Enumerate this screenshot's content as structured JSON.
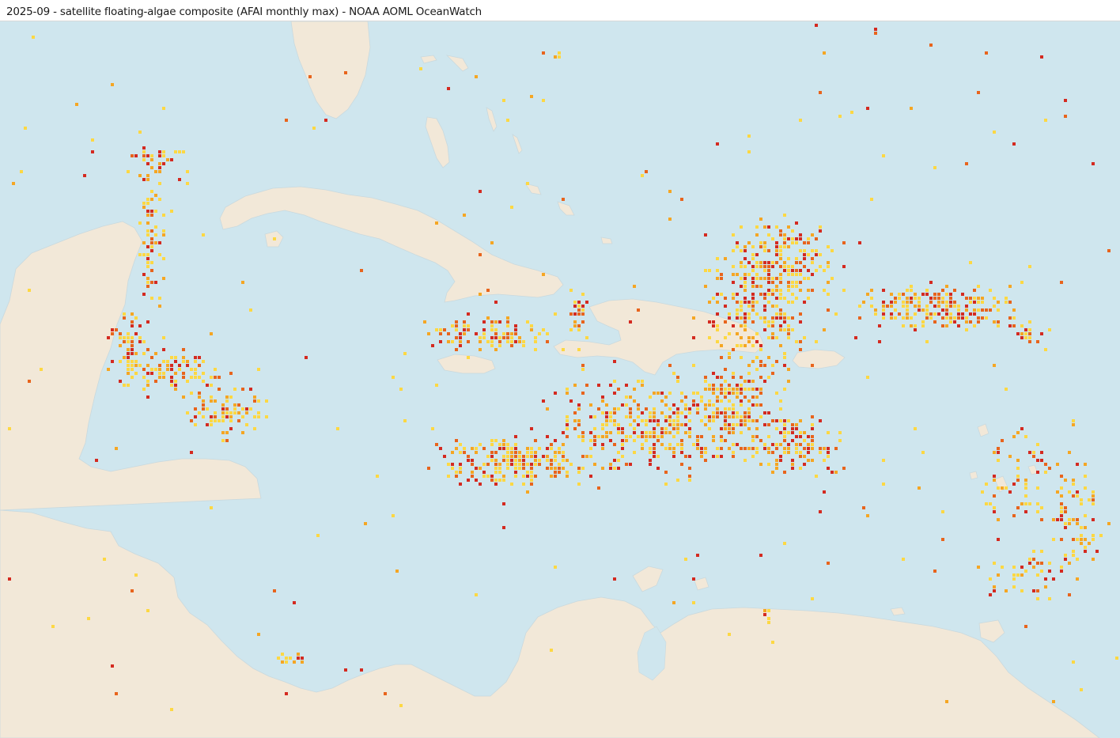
{
  "title": "2025-09 - satellite floating-algae composite (AFAI monthly max) - NOAA AOML OceanWatch",
  "colors": {
    "ocean": "#cfe6ee",
    "land": "#f2e8d8",
    "coast": "#c9d9de",
    "algae_low": "#fdd843",
    "algae_mid": "#f5a623",
    "algae_high": "#e8641c",
    "algae_max": "#d42a20"
  }
}
